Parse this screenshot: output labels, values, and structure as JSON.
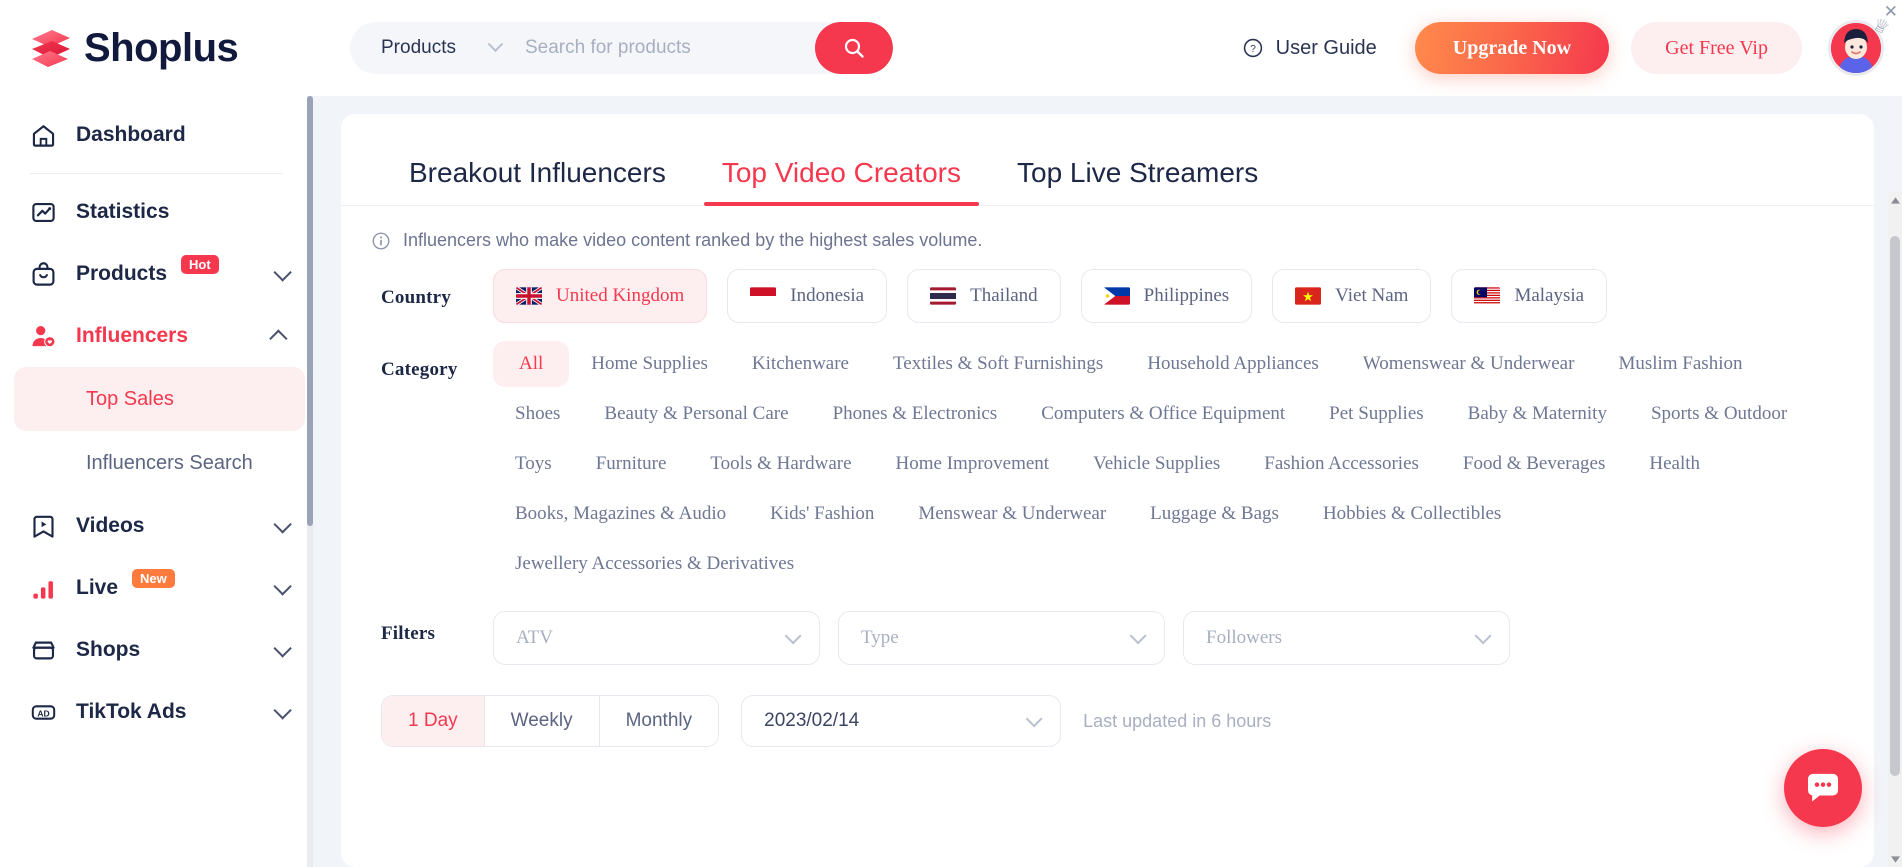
{
  "header": {
    "brand": "Shoplus",
    "search": {
      "category": "Products",
      "value": "",
      "placeholder": "Search for products"
    },
    "user_guide": "User Guide",
    "upgrade": "Upgrade Now",
    "vip": "Get Free Vip",
    "icons": {
      "search": "search-icon",
      "help": "question-circle-icon",
      "chevron": "chevron-down-icon"
    },
    "colors": {
      "accent": "#f5384e",
      "upgrade_gradient_start": "#ff8a4c",
      "upgrade_gradient_end": "#f5384e"
    }
  },
  "sidebar": {
    "items": [
      {
        "label": "Dashboard",
        "icon": "home-icon",
        "expandable": false,
        "active": false,
        "badge": null
      },
      {
        "label": "Statistics",
        "icon": "chart-line-icon",
        "expandable": false,
        "active": false,
        "badge": null
      },
      {
        "label": "Products",
        "icon": "bag-icon",
        "expandable": true,
        "active": false,
        "badge": "Hot",
        "badge_color": "#f5384e"
      },
      {
        "label": "Influencers",
        "icon": "person-heart-icon",
        "expandable": true,
        "active": true,
        "badge": null
      },
      {
        "label": "Videos",
        "icon": "video-bookmark-icon",
        "expandable": true,
        "active": false,
        "badge": null
      },
      {
        "label": "Live",
        "icon": "bar-chart-icon",
        "expandable": true,
        "active": false,
        "badge": "New",
        "badge_color": "#ff7a3d"
      },
      {
        "label": "Shops",
        "icon": "store-icon",
        "expandable": true,
        "active": false,
        "badge": null
      },
      {
        "label": "TikTok Ads",
        "icon": "ad-icon",
        "expandable": true,
        "active": false,
        "badge": null
      }
    ],
    "sub_items": [
      {
        "label": "Top Sales",
        "active": true
      },
      {
        "label": "Influencers Search",
        "active": false
      }
    ]
  },
  "main": {
    "tabs": [
      {
        "label": "Breakout Influencers",
        "active": false
      },
      {
        "label": "Top Video Creators",
        "active": true
      },
      {
        "label": "Top Live Streamers",
        "active": false
      }
    ],
    "info_note": "Influencers who make video content ranked by the highest sales volume.",
    "country": {
      "label": "Country",
      "options": [
        {
          "label": "United Kingdom",
          "flag": "gb",
          "active": true
        },
        {
          "label": "Indonesia",
          "flag": "id",
          "active": false
        },
        {
          "label": "Thailand",
          "flag": "th",
          "active": false
        },
        {
          "label": "Philippines",
          "flag": "ph",
          "active": false
        },
        {
          "label": "Viet Nam",
          "flag": "vn",
          "active": false
        },
        {
          "label": "Malaysia",
          "flag": "my",
          "active": false
        }
      ]
    },
    "category": {
      "label": "Category",
      "options": [
        {
          "label": "All",
          "active": true
        },
        {
          "label": "Home Supplies",
          "active": false
        },
        {
          "label": "Kitchenware",
          "active": false
        },
        {
          "label": "Textiles & Soft Furnishings",
          "active": false
        },
        {
          "label": "Household Appliances",
          "active": false
        },
        {
          "label": "Womenswear & Underwear",
          "active": false
        },
        {
          "label": "Muslim Fashion",
          "active": false
        },
        {
          "label": "Shoes",
          "active": false
        },
        {
          "label": "Beauty & Personal Care",
          "active": false
        },
        {
          "label": "Phones & Electronics",
          "active": false
        },
        {
          "label": "Computers & Office Equipment",
          "active": false
        },
        {
          "label": "Pet Supplies",
          "active": false
        },
        {
          "label": "Baby & Maternity",
          "active": false
        },
        {
          "label": "Sports & Outdoor",
          "active": false
        },
        {
          "label": "Toys",
          "active": false
        },
        {
          "label": "Furniture",
          "active": false
        },
        {
          "label": "Tools & Hardware",
          "active": false
        },
        {
          "label": "Home Improvement",
          "active": false
        },
        {
          "label": "Vehicle Supplies",
          "active": false
        },
        {
          "label": "Fashion Accessories",
          "active": false
        },
        {
          "label": "Food & Beverages",
          "active": false
        },
        {
          "label": "Health",
          "active": false
        },
        {
          "label": "Books, Magazines & Audio",
          "active": false
        },
        {
          "label": "Kids' Fashion",
          "active": false
        },
        {
          "label": "Menswear & Underwear",
          "active": false
        },
        {
          "label": "Luggage & Bags",
          "active": false
        },
        {
          "label": "Hobbies & Collectibles",
          "active": false
        },
        {
          "label": "Jewellery Accessories & Derivatives",
          "active": false
        }
      ]
    },
    "filters": {
      "label": "Filters",
      "selects": [
        {
          "placeholder": "ATV",
          "value": ""
        },
        {
          "placeholder": "Type",
          "value": ""
        },
        {
          "placeholder": "Followers",
          "value": ""
        }
      ]
    },
    "period": {
      "segments": [
        {
          "label": "1 Day",
          "active": true
        },
        {
          "label": "Weekly",
          "active": false
        },
        {
          "label": "Monthly",
          "active": false
        }
      ],
      "date": "2023/02/14",
      "last_updated": "Last updated in 6 hours"
    }
  },
  "chat": {
    "icon": "chat-bubble-icon"
  }
}
